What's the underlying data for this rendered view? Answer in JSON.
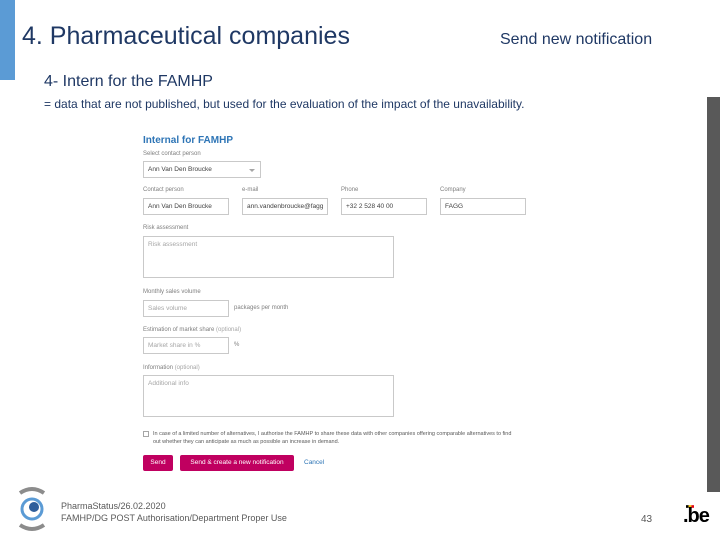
{
  "slide": {
    "title": "4. Pharmaceutical companies",
    "subtitle": "Send new notification",
    "section_heading": "4- Intern for the FAMHP",
    "section_description": "= data that are not published, but used for the evaluation of the impact of the unavailability."
  },
  "form": {
    "title": "Internal for FAMHP",
    "select_contact_label": "Select contact person",
    "select_contact_value": "Ann Van Den Broucke",
    "contact_person_label": "Contact person",
    "contact_person_value": "Ann Van Den Broucke",
    "email_label": "e-mail",
    "email_value": "ann.vandenbroucke@fagg",
    "phone_label": "Phone",
    "phone_value": "+32 2 528 40 00",
    "company_label": "Company",
    "company_value": "FAGG",
    "risk_label": "Risk assessment",
    "risk_placeholder": "Risk assessment",
    "sales_label": "Monthly sales volume",
    "sales_placeholder": "Sales volume",
    "sales_unit": "packages per month",
    "market_label": "Estimation of market share",
    "market_label_optional": "(optional)",
    "market_placeholder": "Market share in %",
    "market_unit": "%",
    "info_label": "Information",
    "info_label_optional": "(optional)",
    "info_placeholder": "Additional info",
    "consent_text": "In case of a limited number of alternatives, I authorise the FAMHP to share these data with other companies offering comparable alternatives to find out whether they can anticipate as much as possible an increase in demand.",
    "send_button": "Send",
    "send_create_button": "Send & create a new notification",
    "cancel_link": "Cancel"
  },
  "footer": {
    "line1": "PharmaStatus/26.02.2020",
    "line2": "FAMHP/DG POST Authorisation/Department Proper Use",
    "page_number": "43",
    "be_logo": ".be"
  },
  "colors": {
    "accent": "#5b9bd5",
    "title_text": "#1f3864",
    "form_title": "#2e75b6",
    "button": "#c00060",
    "side_bar": "#595959"
  }
}
